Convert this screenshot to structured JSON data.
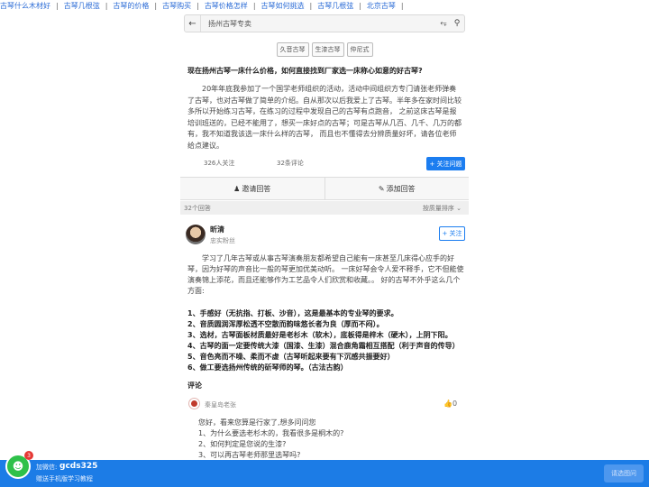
{
  "top_links": [
    "古琴什么木材好",
    "古琴几根弦",
    "古琴的价格",
    "古琴购买",
    "古琴价格怎样",
    "古琴如何挑选",
    "古琴几根弦",
    "北京古琴"
  ],
  "search": {
    "text": "扬州古琴专卖",
    "back_icon": "arrow-left-icon",
    "share_icon": "share-icon",
    "search_icon": "search-icon"
  },
  "tags": [
    "久音古琴",
    "生漆古琴",
    "仲尼式"
  ],
  "question": {
    "title": "现在扬州古琴一床什么价格，如何直接找到厂家选一床称心如意的好古琴?",
    "body": "20年年底我参加了一个国学老师组织的活动，活动中间组织方专门请张老师弹奏了古琴，也对古琴做了简单的介绍。自从那次以后我爱上了古琴。半年多在家时间比较多所以开始练习古琴，在练习的过程中发现自己的古琴有点跑音， 之前这床古琴是报培训班送的，已经不能用了，想买一床好点的古琴；可是古琴从几百、几千、几万的都有，我不知道我该选一床什么样的古琴， 而且也不懂得去分辨质量好坏，请各位老师给点建议。",
    "followers": "326人关注",
    "comments": "32条评论",
    "follow_label": "+ 关注问题"
  },
  "actions": {
    "invite": "邀请回答",
    "answer": "添加回答"
  },
  "answers_header": {
    "count": "32个回答",
    "sort": "按质量排序"
  },
  "answer": {
    "username": "昕清",
    "user_title": "忠实粉丝",
    "follow_label": "+ 关注",
    "body": "学习了几年古琴或从事古琴演奏朋友都希望自己能有一床甚至几床得心应手的好琴，因为好琴的声音比一般的琴更加优美动听。 一床好琴会令人爱不释手，它不但能使演奏锦上添花，而且还能够作为工艺品令人们欣赏和收藏。。 好的古琴不外乎这么几个方面:",
    "points": [
      "1、手感好（无抗指、打板、沙音），这是最基本的专业琴的要求。",
      "2、音质圆润浑厚松透不空散而韵味悠长者为良（厚而不闷）。",
      "3、选材，古琴面板材质最好是老杉木（软木），底板得是梓木（硬木），上阴下阳。",
      "4、古琴的面一定要传统大漆（国漆、生漆）混合鹿角霜相互搭配（利于声音的传导）",
      "5、音色亮而不噪、柔而不虚（古琴听起来要有下沉感共振要好）",
      "6、做工要选扬州传统的斫琴师的琴。（古法古韵）"
    ]
  },
  "comments": {
    "title": "评论",
    "items": [
      {
        "user": "秦皇岛老张",
        "likes": "0",
        "lines": [
          "您好，看来您算是行家了,想多问问您",
          "1、为什么要选老杉木的，我看很多是桐木的?",
          "2、如何判定是您说的生漆?",
          "3、可以再古琴老师那里选琴吗?"
        ]
      }
    ]
  },
  "bottom_bar": {
    "label": "加微信:",
    "wechat_id": "gcds325",
    "sub": "赠送手机版学习教程",
    "badge": "3",
    "ask_label": "请选图问"
  },
  "colors": {
    "accent": "#1b7df0",
    "bar": "#1c7ce6",
    "wechat": "#2ec14a"
  }
}
